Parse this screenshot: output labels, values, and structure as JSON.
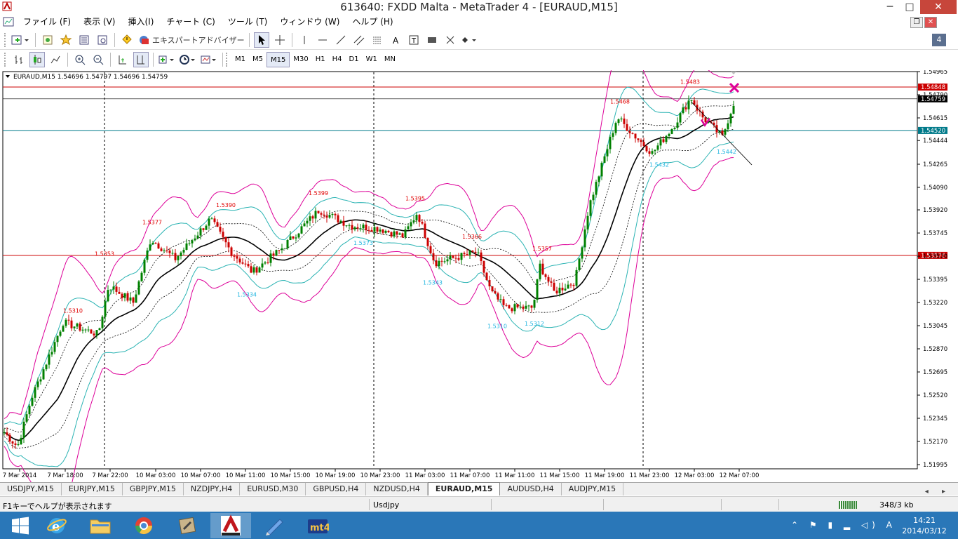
{
  "window": {
    "title": "613640: FXDD Malta - MetaTrader 4 - [EURAUD,M15]",
    "minimize": "─",
    "maximize": "□",
    "close": "✕"
  },
  "menu": [
    "ファイル (F)",
    "表示 (V)",
    "挿入(I)",
    "チャート (C)",
    "ツール (T)",
    "ウィンドウ (W)",
    "ヘルプ (H)"
  ],
  "mdi": {
    "restore": "❐",
    "close": "✕"
  },
  "toolbar": {
    "expert_advisor": "エキスパートアドバイザー",
    "notification_count": "4"
  },
  "timeframes": [
    "M1",
    "M5",
    "M15",
    "M30",
    "H1",
    "H4",
    "D1",
    "W1",
    "MN"
  ],
  "timeframe_selected": "M15",
  "chart": {
    "info_line": "EURAUD,M15  1.54696 1.54797 1.54696 1.54759",
    "price_labels": [
      "1.54965",
      "1.54790",
      "1.54615",
      "1.54444",
      "1.54265",
      "1.54090",
      "1.53920",
      "1.53745",
      "1.53570",
      "1.53395",
      "1.53220",
      "1.53045",
      "1.52870",
      "1.52695",
      "1.52520",
      "1.52345",
      "1.52170",
      "1.51995"
    ],
    "time_labels": [
      "7 Mar 2014",
      "7 Mar 18:00",
      "7 Mar 22:00",
      "10 Mar 03:00",
      "10 Mar 07:00",
      "10 Mar 11:00",
      "10 Mar 15:00",
      "10 Mar 19:00",
      "10 Mar 23:00",
      "11 Mar 03:00",
      "11 Mar 07:00",
      "11 Mar 11:00",
      "11 Mar 15:00",
      "11 Mar 19:00",
      "11 Mar 23:00",
      "12 Mar 03:00",
      "12 Mar 07:00"
    ],
    "hlines": [
      {
        "value": "1.54848",
        "color": "#cc0000"
      },
      {
        "value": "1.54759",
        "color": "#000000"
      },
      {
        "value": "1.54520",
        "color": "#007a8a"
      },
      {
        "value": "1.53576",
        "color": "#cc0000"
      }
    ],
    "zigzag_high_labels": [
      "1.5310",
      "1.5353",
      "1.5377",
      "1.5390",
      "1.5399",
      "1.5395",
      "1.5366",
      "1.5357",
      "1.5468",
      "1.5483"
    ],
    "zigzag_low_labels": [
      "1.5334",
      "1.5373",
      "1.5343",
      "1.5310",
      "1.5312",
      "1.5432",
      "1.5442"
    ],
    "colors": {
      "candle_up": "#008000",
      "candle_down": "#cc0000",
      "outer_band": "#dd0099",
      "mid_band": "#2ab3b3",
      "ma": "#000000",
      "high_label": "#e00000",
      "low_label": "#20b5e0"
    }
  },
  "tabs": [
    "USDJPY,M15",
    "EURJPY,M15",
    "GBPJPY,M15",
    "NZDJPY,H4",
    "EURUSD,M30",
    "GBPUSD,H4",
    "NZDUSD,H4",
    "EURAUD,M15",
    "AUDUSD,H4",
    "AUDJPY,M15"
  ],
  "tab_active": "EURAUD,M15",
  "tab_scroll": "◂ ▸",
  "status": {
    "help": "F1キーでヘルプが表示されます",
    "profile": "Usdjpy",
    "connection": "348/3 kb"
  },
  "taskbar": {
    "time": "14:21",
    "date": "2014/03/12",
    "tray": "⌃ ⚑ ▮ ▂ ◁) A"
  }
}
